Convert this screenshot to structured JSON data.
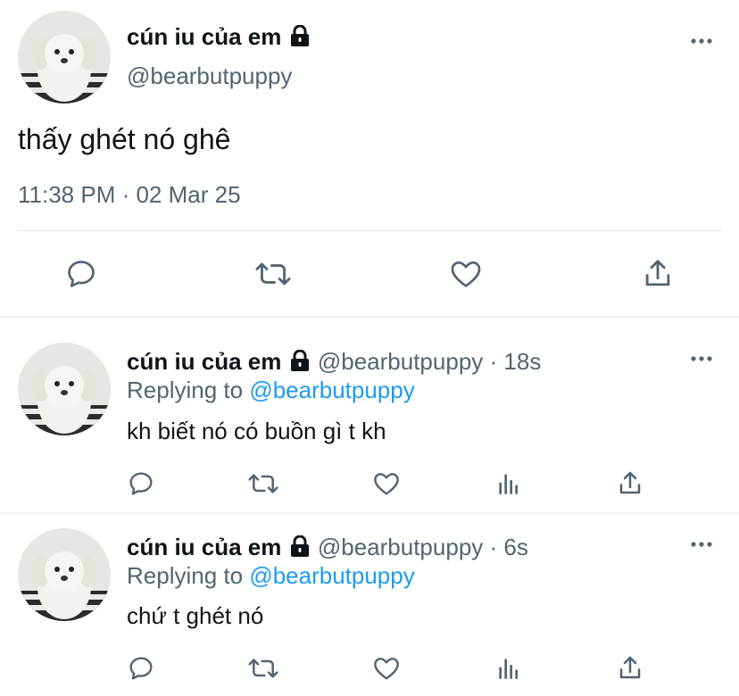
{
  "main_tweet": {
    "display_name": "cún iu của em",
    "handle": "@bearbutpuppy",
    "text": "thấy ghét nó ghê",
    "timestamp": "11:38 PM · 02 Mar 25",
    "actions": [
      "reply-icon",
      "retweet-icon",
      "like-icon",
      "share-icon"
    ]
  },
  "replies": [
    {
      "display_name": "cún iu của em",
      "handle": "@bearbutpuppy",
      "dot": "·",
      "time": "18s",
      "replying_prefix": "Replying to",
      "replying_to": "@bearbutpuppy",
      "text": "kh biết nó có buồn gì t kh",
      "actions": [
        "reply-icon",
        "retweet-icon",
        "like-icon",
        "analytics-icon",
        "share-icon"
      ]
    },
    {
      "display_name": "cún iu của em",
      "handle": "@bearbutpuppy",
      "dot": "·",
      "time": "6s",
      "replying_prefix": "Replying to",
      "replying_to": "@bearbutpuppy",
      "text": "chứ t ghét nó",
      "actions": [
        "reply-icon",
        "retweet-icon",
        "like-icon",
        "analytics-icon",
        "share-icon"
      ]
    }
  ],
  "colors": {
    "text": "#0f1419",
    "secondary": "#536471",
    "link": "#1d9bf0",
    "divider": "#eff3f4"
  }
}
